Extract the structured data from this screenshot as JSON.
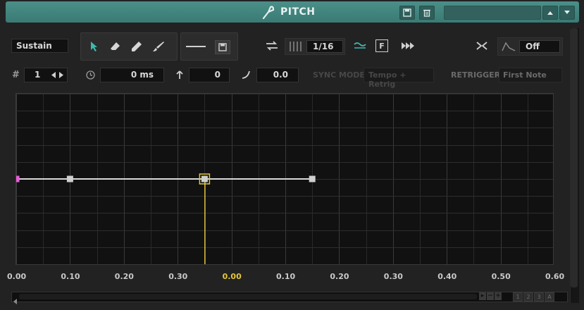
{
  "header": {
    "title": "PITCH",
    "fork_icon": "tuning-fork-icon",
    "save_icon": "save-icon",
    "delete_icon": "trash-icon",
    "preset_value": ""
  },
  "toolbar": {
    "mode": "Sustain",
    "step_value": "1/16",
    "filter_off": "Off",
    "sync_mode_label": "SYNC MODE",
    "sync_mode_value": "Tempo + Retrig",
    "retrigger_label": "RETRIGGER",
    "retrigger_value": "First Note"
  },
  "fields": {
    "node_index": "1",
    "time": "0 ms",
    "level": "0",
    "curve": "0.0"
  },
  "axis": {
    "ticks": [
      "0.00",
      "0.10",
      "0.20",
      "0.30",
      "0.00",
      "0.10",
      "0.20",
      "0.30",
      "0.40",
      "0.50",
      "0.60"
    ],
    "highlight_index": 4
  },
  "colors": {
    "accent": "#3b7a74",
    "highlight": "#e5c63a",
    "start_node": "#e65fd5",
    "line": "#d9d9d9"
  },
  "envelope": {
    "level": 0.5,
    "nodes": [
      {
        "t": 0.0,
        "kind": "start"
      },
      {
        "t": 0.1,
        "kind": "node"
      },
      {
        "t": 0.35,
        "kind": "sustain"
      },
      {
        "t": 0.55,
        "kind": "node"
      }
    ]
  },
  "scroll": {
    "zoom_buttons": [
      "1",
      "2",
      "3",
      "A"
    ]
  }
}
